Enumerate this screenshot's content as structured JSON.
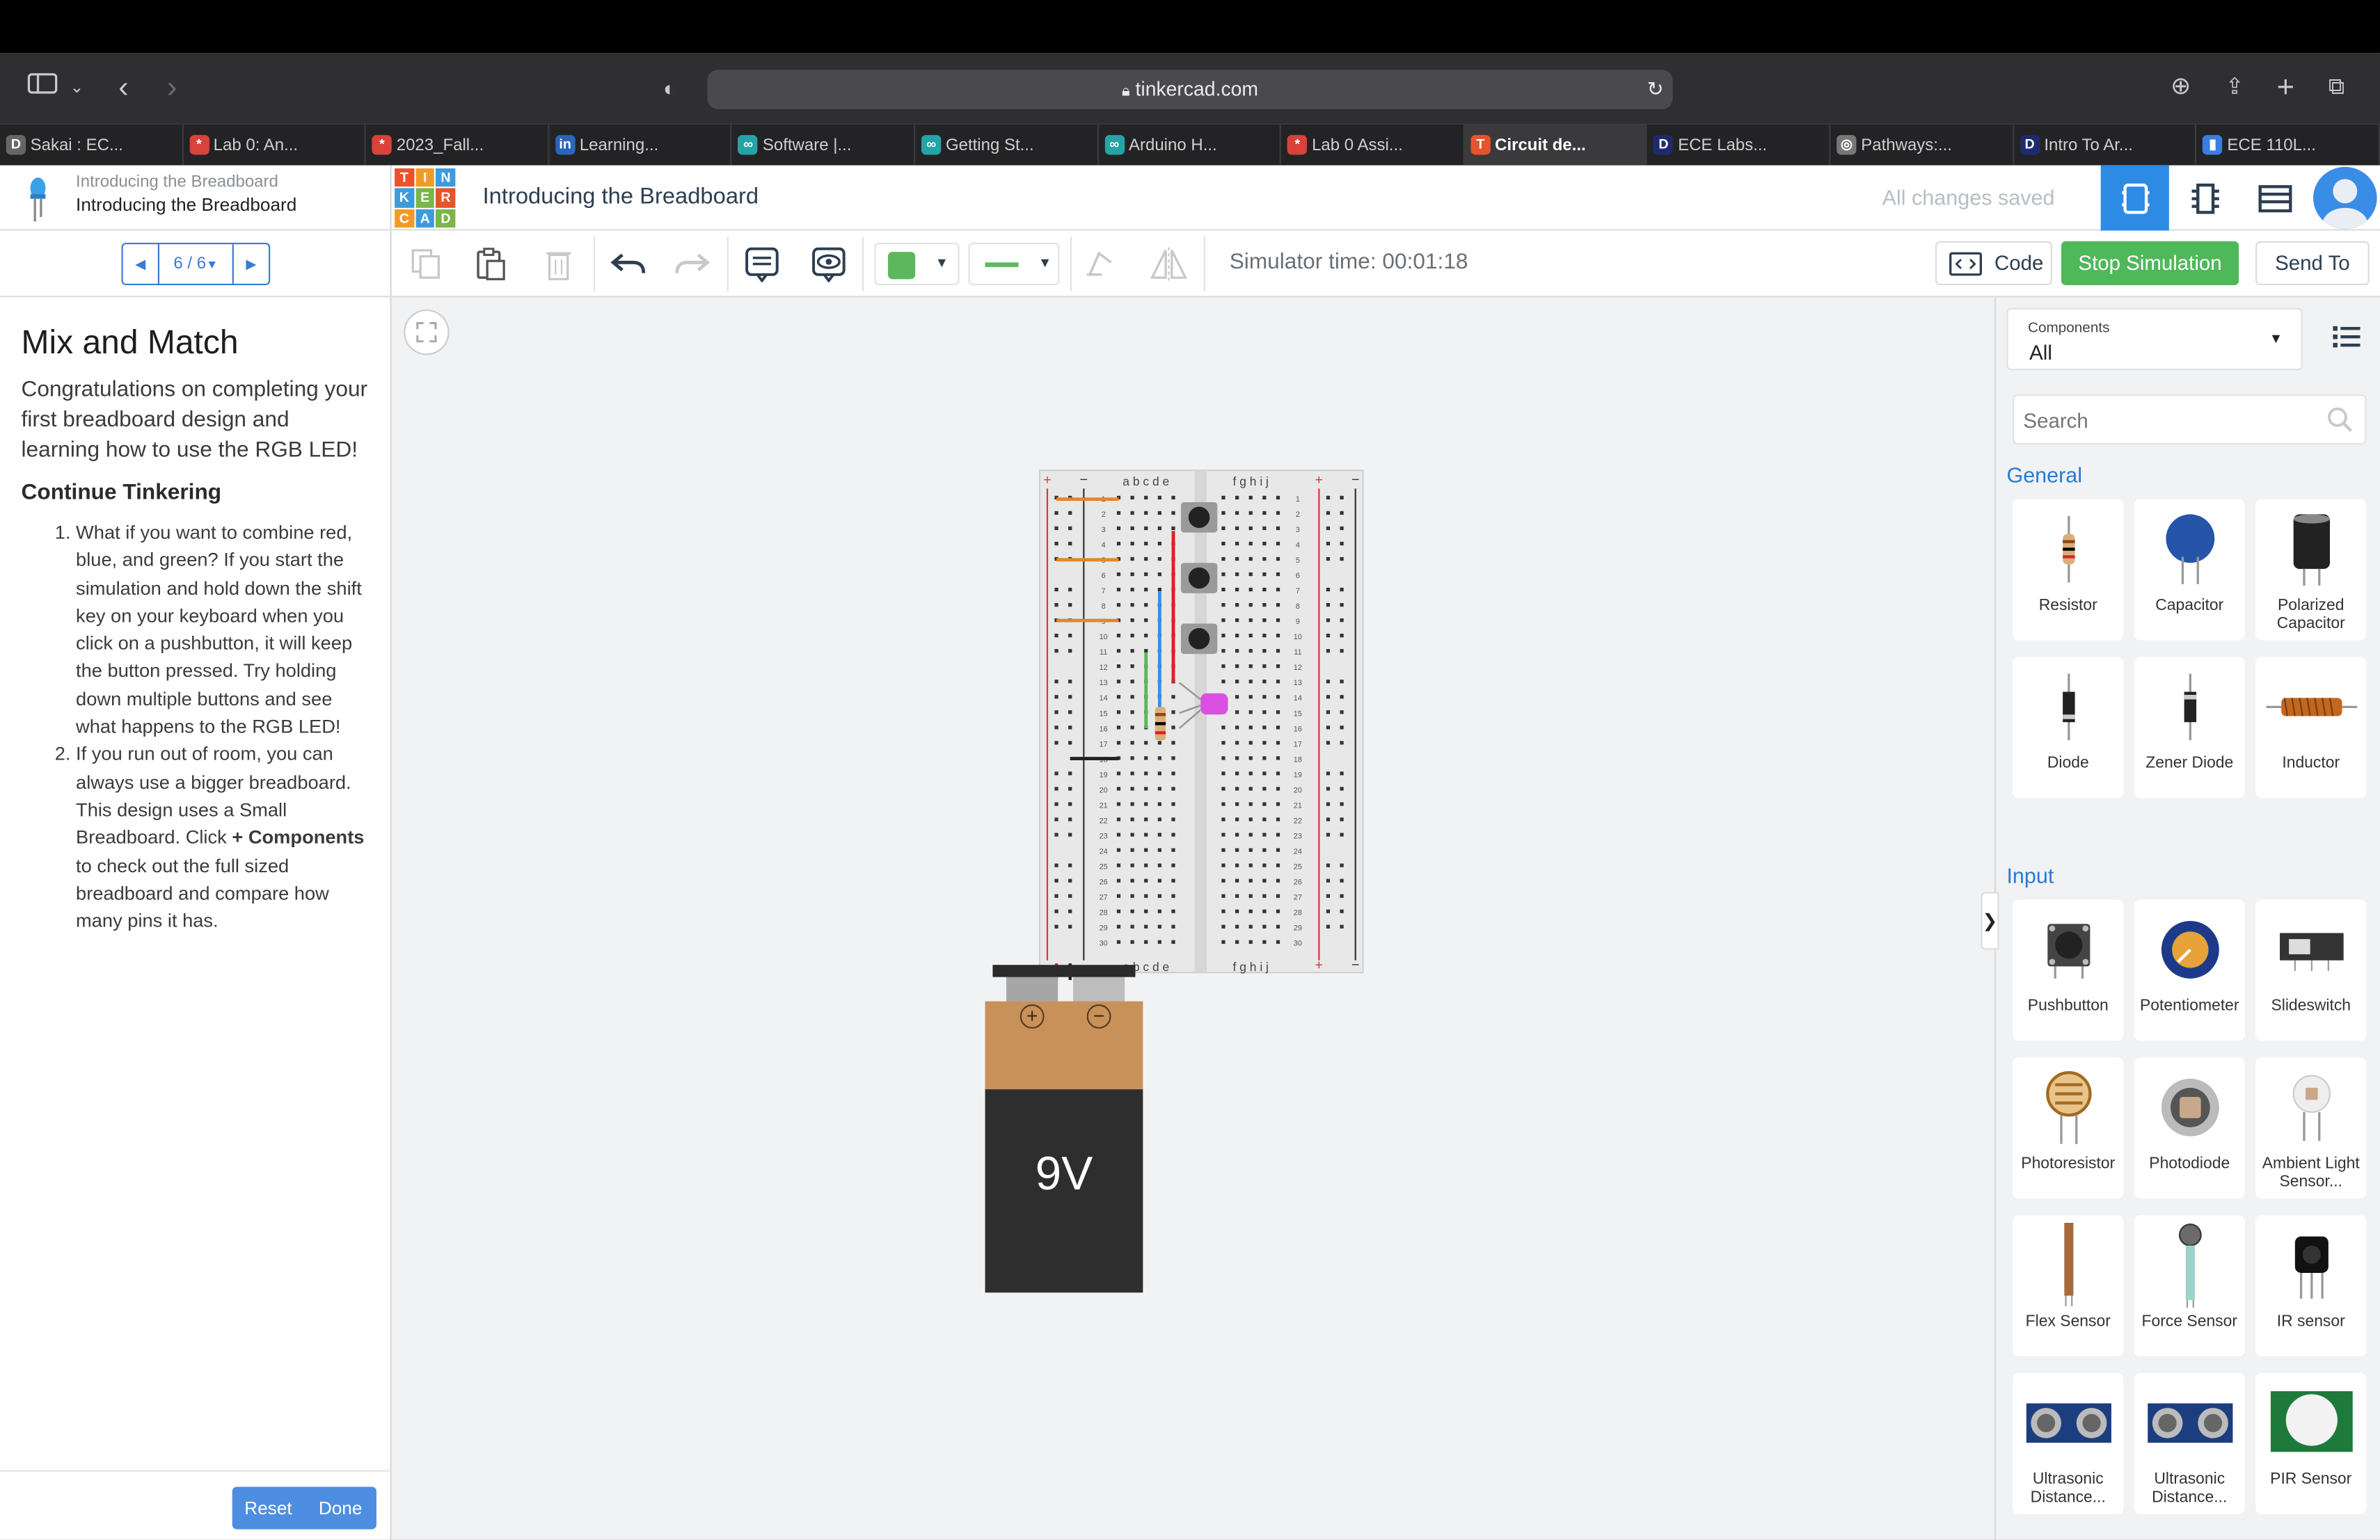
{
  "browser": {
    "url": "tinkercad.com",
    "tabs": [
      {
        "label": "Sakai : EC...",
        "icon": "D",
        "color": "#666"
      },
      {
        "label": "Lab 0: An...",
        "icon": "*",
        "color": "#d9413a"
      },
      {
        "label": "2023_Fall...",
        "icon": "*",
        "color": "#d9413a"
      },
      {
        "label": "Learning...",
        "icon": "in",
        "color": "#2a66bc"
      },
      {
        "label": "Software |...",
        "icon": "∞",
        "color": "#26a3a5"
      },
      {
        "label": "Getting St...",
        "icon": "∞",
        "color": "#26a3a5"
      },
      {
        "label": "Arduino H...",
        "icon": "∞",
        "color": "#26a3a5"
      },
      {
        "label": "Lab 0 Assi...",
        "icon": "*",
        "color": "#d9413a"
      },
      {
        "label": "Circuit de...",
        "icon": "T",
        "color": "#e8532b",
        "active": true
      },
      {
        "label": "ECE Labs...",
        "icon": "D",
        "color": "#1f2a6e"
      },
      {
        "label": "Pathways:...",
        "icon": "◎",
        "color": "#777"
      },
      {
        "label": "Intro To Ar...",
        "icon": "D",
        "color": "#1f2a6e"
      },
      {
        "label": "ECE 110L...",
        "icon": "▮",
        "color": "#3b7de0"
      }
    ]
  },
  "lesson": {
    "header_small": "Introducing the Breadboard",
    "header_title": "Introducing the Breadboard",
    "pager": "6 / 6",
    "title": "Mix and Match",
    "intro": "Congratulations on completing your first breadboard design and learning how to use the RGB LED!",
    "subtitle": "Continue Tinkering",
    "item1": "What if you want to combine red, blue, and green? If you start the simulation and hold down the shift key on your keyboard when you click on a pushbutton, it will keep the button pressed. Try holding down multiple buttons and see what happens to the RGB LED!",
    "item2_a": "If you run out of room, you can always use a bigger breadboard. This design uses a Small Breadboard. Click ",
    "item2_b": "+ Components",
    "item2_c": " to check out the full sized breadboard and compare how many pins it has.",
    "reset": "Reset",
    "done": "Done"
  },
  "app": {
    "logo_letters": [
      "T",
      "I",
      "N",
      "K",
      "E",
      "R",
      "C",
      "A",
      "D"
    ],
    "logo_colors": [
      "#e8532b",
      "#f39a26",
      "#3d9bdb",
      "#3d9bdb",
      "#7ab648",
      "#e8532b",
      "#f39a26",
      "#3d9bdb",
      "#7ab648"
    ],
    "project_name": "Introducing the Breadboard",
    "saved_status": "All changes saved"
  },
  "toolbar": {
    "sim_time": "Simulator time: 00:01:18",
    "code": "Code",
    "stop": "Stop Simulation",
    "send": "Send To",
    "fill_color": "#5cb85c",
    "accent": "#2d8be6",
    "stop_color": "#4fb85a"
  },
  "canvas": {
    "battery_label": "9V",
    "plus": "+",
    "minus": "−",
    "bb_cols_left": "a b c d e",
    "bb_cols_right": "f g h i j"
  },
  "components": {
    "filter_label": "Components",
    "filter_value": "All",
    "search_placeholder": "Search",
    "general_title": "General",
    "input_title": "Input",
    "general": [
      "Resistor",
      "Capacitor",
      "Polarized Capacitor",
      "Diode",
      "Zener Diode",
      "Inductor"
    ],
    "input": [
      "Pushbutton",
      "Potentiometer",
      "Slideswitch",
      "Photoresistor",
      "Photodiode",
      "Ambient Light Sensor...",
      "Flex Sensor",
      "Force Sensor",
      "IR sensor",
      "Ultrasonic Distance...",
      "Ultrasonic Distance...",
      "PIR Sensor"
    ],
    "collapse_arrow": "❯"
  }
}
